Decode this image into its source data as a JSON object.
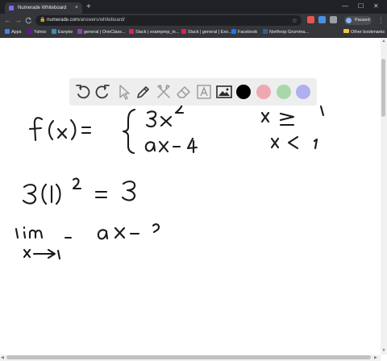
{
  "browser": {
    "tab_title": "Numerade Whiteboard",
    "tab_close": "×",
    "new_tab": "+",
    "window_controls": {
      "minimize": "—",
      "maximize": "☐",
      "close": "✕"
    },
    "nav": {
      "back": "←",
      "forward": "→",
      "reload": "C"
    },
    "url_host": "numerade.com",
    "url_path": "/answers/whiteboard/",
    "star": "☆",
    "profile_label": "Paused",
    "menu": "⋮"
  },
  "bookmarks": {
    "items": [
      {
        "label": "Apps",
        "color": "#4285f4"
      },
      {
        "label": "Yahoo",
        "color": "#720e9e"
      },
      {
        "label": "Eanyke",
        "color": "#3c8dbc"
      },
      {
        "label": "general | OneClass...",
        "color": "#8e44ad"
      },
      {
        "label": "Slack | examprep_in...",
        "color": "#e01e5a"
      },
      {
        "label": "Slack | general | Exo...",
        "color": "#e01e5a"
      },
      {
        "label": "Facebook",
        "color": "#1877f2"
      },
      {
        "label": "Northrop Grumma...",
        "color": "#2c5f9e"
      }
    ],
    "other": "Other bookmarks"
  },
  "toolbar": {
    "tools": [
      "undo-icon",
      "redo-icon",
      "pointer-icon",
      "pen-icon",
      "tools-icon",
      "eraser-icon",
      "text-icon",
      "image-icon"
    ],
    "colors": [
      "#000000",
      "#f0a8b0",
      "#a8d8a8",
      "#b0b0f0"
    ]
  }
}
